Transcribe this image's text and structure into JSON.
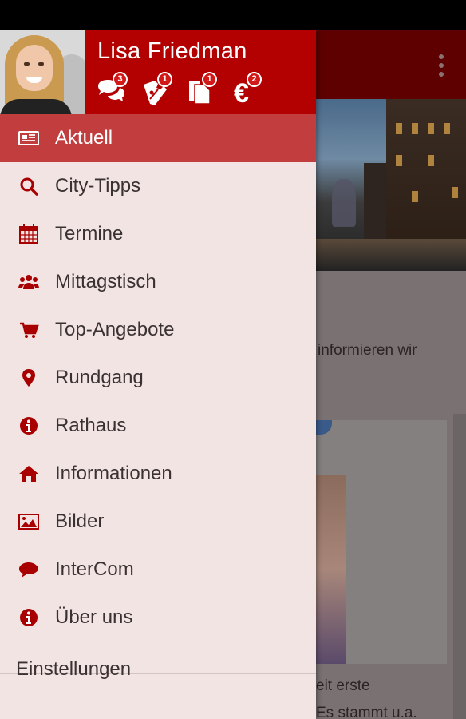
{
  "user": {
    "name": "Lisa Friedman"
  },
  "badges": [
    {
      "icon": "chat-bubbles-icon",
      "count": "3"
    },
    {
      "icon": "coupons-icon",
      "count": "1"
    },
    {
      "icon": "documents-icon",
      "count": "1"
    },
    {
      "icon": "euro-icon",
      "count": "2"
    }
  ],
  "menu": [
    {
      "label": "Aktuell",
      "icon": "newspaper-icon",
      "active": true
    },
    {
      "label": "City-Tipps",
      "icon": "search-icon"
    },
    {
      "label": "Termine",
      "icon": "calendar-icon"
    },
    {
      "label": "Mittagstisch",
      "icon": "group-icon"
    },
    {
      "label": "Top-Angebote",
      "icon": "cart-icon"
    },
    {
      "label": "Rundgang",
      "icon": "map-marker-icon"
    },
    {
      "label": "Rathaus",
      "icon": "info-icon"
    },
    {
      "label": "Informationen",
      "icon": "home-icon"
    },
    {
      "label": "Bilder",
      "icon": "image-icon"
    },
    {
      "label": "InterCom",
      "icon": "chat-bubble-icon"
    },
    {
      "label": "Über uns",
      "icon": "info-icon"
    }
  ],
  "settings": {
    "label": "Einstellungen"
  },
  "background": {
    "text1": "informieren wir",
    "text2": "eit erste",
    "text3": "Es stammt u.a."
  },
  "colors": {
    "accent": "#b30000",
    "active_row": "#c23d3d",
    "drawer_bg": "#f3e4e4",
    "icon": "#a80000"
  }
}
